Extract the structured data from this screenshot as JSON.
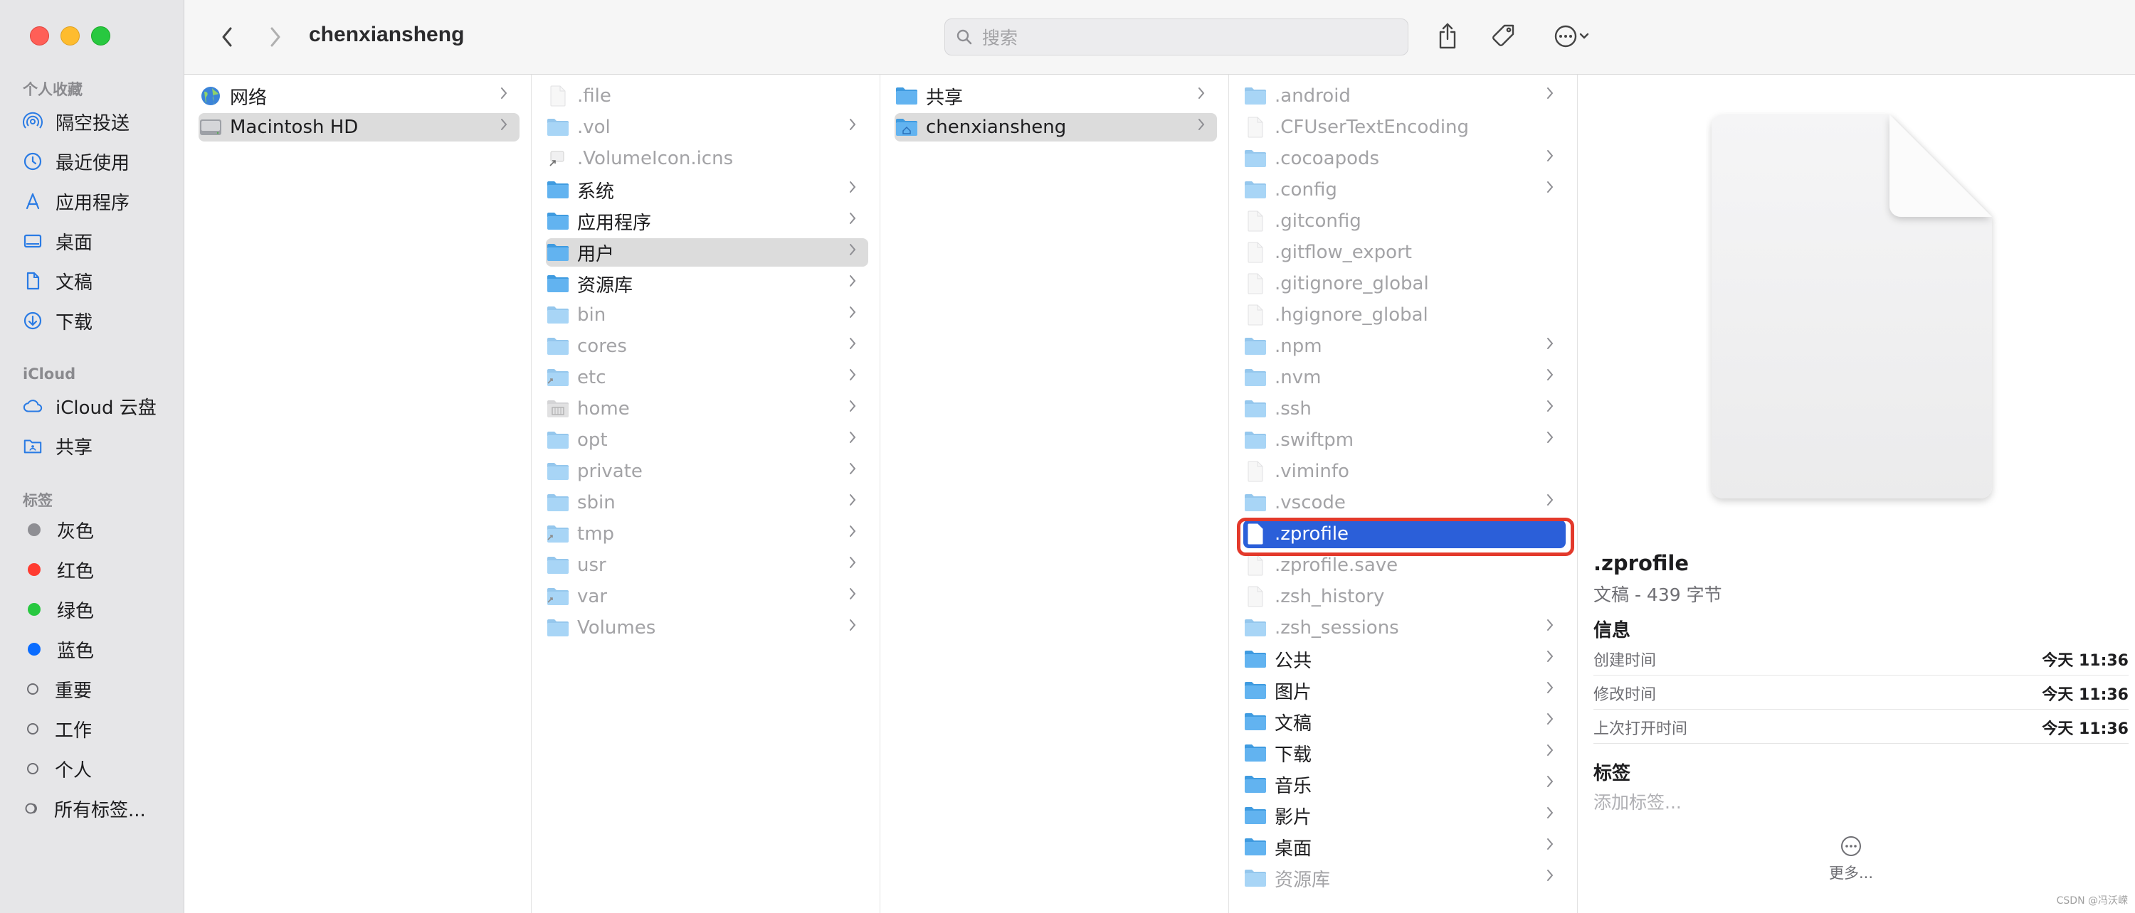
{
  "window": {
    "title": "chenxiansheng"
  },
  "sidebar": {
    "favorites_header": "个人收藏",
    "favorites": [
      {
        "label": "隔空投送",
        "icon": "airdrop-icon"
      },
      {
        "label": "最近使用",
        "icon": "clock-icon"
      },
      {
        "label": "应用程序",
        "icon": "applications-icon"
      },
      {
        "label": "桌面",
        "icon": "desktop-icon"
      },
      {
        "label": "文稿",
        "icon": "document-icon"
      },
      {
        "label": "下载",
        "icon": "download-icon"
      }
    ],
    "icloud_header": "iCloud",
    "icloud": [
      {
        "label": "iCloud 云盘",
        "icon": "cloud-icon"
      },
      {
        "label": "共享",
        "icon": "shared-folder-icon"
      }
    ],
    "tags_header": "标签",
    "tags": [
      {
        "label": "灰色",
        "color": "#8e8e93"
      },
      {
        "label": "红色",
        "color": "#ff3b30"
      },
      {
        "label": "绿色",
        "color": "#28c840"
      },
      {
        "label": "蓝色",
        "color": "#0a6cff"
      },
      {
        "label": "重要",
        "color": ""
      },
      {
        "label": "工作",
        "color": ""
      },
      {
        "label": "个人",
        "color": ""
      },
      {
        "label": "所有标签...",
        "color": ""
      }
    ]
  },
  "toolbar": {
    "search_placeholder": "搜索"
  },
  "columns": [
    [
      {
        "label": "网络",
        "icon": "globe-icon",
        "chev": true,
        "dim": false,
        "sel": ""
      },
      {
        "label": "Macintosh HD",
        "icon": "harddrive-icon",
        "chev": true,
        "dim": false,
        "sel": "gray"
      }
    ],
    [
      {
        "label": ".file",
        "icon": "file-icon",
        "chev": false,
        "dim": true,
        "sel": ""
      },
      {
        "label": ".vol",
        "icon": "folder-icon",
        "chev": true,
        "dim": true,
        "sel": ""
      },
      {
        "label": ".VolumeIcon.icns",
        "icon": "icns-icon",
        "chev": false,
        "dim": true,
        "sel": ""
      },
      {
        "label": "系统",
        "icon": "folder-icon",
        "chev": true,
        "dim": false,
        "sel": ""
      },
      {
        "label": "应用程序",
        "icon": "folder-icon",
        "chev": true,
        "dim": false,
        "sel": ""
      },
      {
        "label": "用户",
        "icon": "folder-icon",
        "chev": true,
        "dim": false,
        "sel": "gray"
      },
      {
        "label": "资源库",
        "icon": "folder-icon",
        "chev": true,
        "dim": false,
        "sel": ""
      },
      {
        "label": "bin",
        "icon": "folder-icon",
        "chev": true,
        "dim": true,
        "sel": ""
      },
      {
        "label": "cores",
        "icon": "folder-icon",
        "chev": true,
        "dim": true,
        "sel": ""
      },
      {
        "label": "etc",
        "icon": "alias-folder-icon",
        "chev": true,
        "dim": true,
        "sel": ""
      },
      {
        "label": "home",
        "icon": "server-folder-icon",
        "chev": true,
        "dim": true,
        "sel": ""
      },
      {
        "label": "opt",
        "icon": "folder-icon",
        "chev": true,
        "dim": true,
        "sel": ""
      },
      {
        "label": "private",
        "icon": "folder-icon",
        "chev": true,
        "dim": true,
        "sel": ""
      },
      {
        "label": "sbin",
        "icon": "folder-icon",
        "chev": true,
        "dim": true,
        "sel": ""
      },
      {
        "label": "tmp",
        "icon": "alias-folder-icon",
        "chev": true,
        "dim": true,
        "sel": ""
      },
      {
        "label": "usr",
        "icon": "folder-icon",
        "chev": true,
        "dim": true,
        "sel": ""
      },
      {
        "label": "var",
        "icon": "alias-folder-icon",
        "chev": true,
        "dim": true,
        "sel": ""
      },
      {
        "label": "Volumes",
        "icon": "folder-icon",
        "chev": true,
        "dim": true,
        "sel": ""
      }
    ],
    [
      {
        "label": "共享",
        "icon": "folder-icon",
        "chev": true,
        "dim": false,
        "sel": ""
      },
      {
        "label": "chenxiansheng",
        "icon": "home-folder-icon",
        "chev": true,
        "dim": false,
        "sel": "gray"
      }
    ],
    [
      {
        "label": ".android",
        "icon": "folder-icon",
        "chev": true,
        "dim": true,
        "sel": ""
      },
      {
        "label": ".CFUserTextEncoding",
        "icon": "file-icon",
        "chev": false,
        "dim": true,
        "sel": ""
      },
      {
        "label": ".cocoapods",
        "icon": "folder-icon",
        "chev": true,
        "dim": true,
        "sel": ""
      },
      {
        "label": ".config",
        "icon": "folder-icon",
        "chev": true,
        "dim": true,
        "sel": ""
      },
      {
        "label": ".gitconfig",
        "icon": "file-icon",
        "chev": false,
        "dim": true,
        "sel": ""
      },
      {
        "label": ".gitflow_export",
        "icon": "file-icon",
        "chev": false,
        "dim": true,
        "sel": ""
      },
      {
        "label": ".gitignore_global",
        "icon": "file-icon",
        "chev": false,
        "dim": true,
        "sel": ""
      },
      {
        "label": ".hgignore_global",
        "icon": "file-icon",
        "chev": false,
        "dim": true,
        "sel": ""
      },
      {
        "label": ".npm",
        "icon": "folder-icon",
        "chev": true,
        "dim": true,
        "sel": ""
      },
      {
        "label": ".nvm",
        "icon": "folder-icon",
        "chev": true,
        "dim": true,
        "sel": ""
      },
      {
        "label": ".ssh",
        "icon": "folder-icon",
        "chev": true,
        "dim": true,
        "sel": ""
      },
      {
        "label": ".swiftpm",
        "icon": "folder-icon",
        "chev": true,
        "dim": true,
        "sel": ""
      },
      {
        "label": ".viminfo",
        "icon": "file-icon",
        "chev": false,
        "dim": true,
        "sel": ""
      },
      {
        "label": ".vscode",
        "icon": "folder-icon",
        "chev": true,
        "dim": true,
        "sel": ""
      },
      {
        "label": ".zprofile",
        "icon": "file-icon",
        "chev": false,
        "dim": false,
        "sel": "blue"
      },
      {
        "label": ".zprofile.save",
        "icon": "file-icon",
        "chev": false,
        "dim": true,
        "sel": ""
      },
      {
        "label": ".zsh_history",
        "icon": "file-icon",
        "chev": false,
        "dim": true,
        "sel": ""
      },
      {
        "label": ".zsh_sessions",
        "icon": "folder-icon",
        "chev": true,
        "dim": true,
        "sel": ""
      },
      {
        "label": "公共",
        "icon": "folder-icon",
        "chev": true,
        "dim": false,
        "sel": ""
      },
      {
        "label": "图片",
        "icon": "folder-icon",
        "chev": true,
        "dim": false,
        "sel": ""
      },
      {
        "label": "文稿",
        "icon": "folder-icon",
        "chev": true,
        "dim": false,
        "sel": ""
      },
      {
        "label": "下载",
        "icon": "folder-icon",
        "chev": true,
        "dim": false,
        "sel": ""
      },
      {
        "label": "音乐",
        "icon": "folder-icon",
        "chev": true,
        "dim": false,
        "sel": ""
      },
      {
        "label": "影片",
        "icon": "folder-icon",
        "chev": true,
        "dim": false,
        "sel": ""
      },
      {
        "label": "桌面",
        "icon": "folder-icon",
        "chev": true,
        "dim": false,
        "sel": ""
      },
      {
        "label": "资源库",
        "icon": "folder-icon",
        "chev": true,
        "dim": true,
        "sel": ""
      }
    ]
  ],
  "preview": {
    "name": ".zprofile",
    "kind": "文稿 - 439 字节",
    "info_header": "信息",
    "info": [
      {
        "key": "创建时间",
        "value": "今天 11:36"
      },
      {
        "key": "修改时间",
        "value": "今天 11:36"
      },
      {
        "key": "上次打开时间",
        "value": "今天 11:36"
      }
    ],
    "tags_header": "标签",
    "tags_placeholder": "添加标签...",
    "more_label": "更多..."
  },
  "watermark": "CSDN @冯沃嵘",
  "colors": {
    "selection_blue": "#2b5fd9",
    "folder_blue": "#5ab0f0",
    "annotation_red": "#e3392b"
  }
}
